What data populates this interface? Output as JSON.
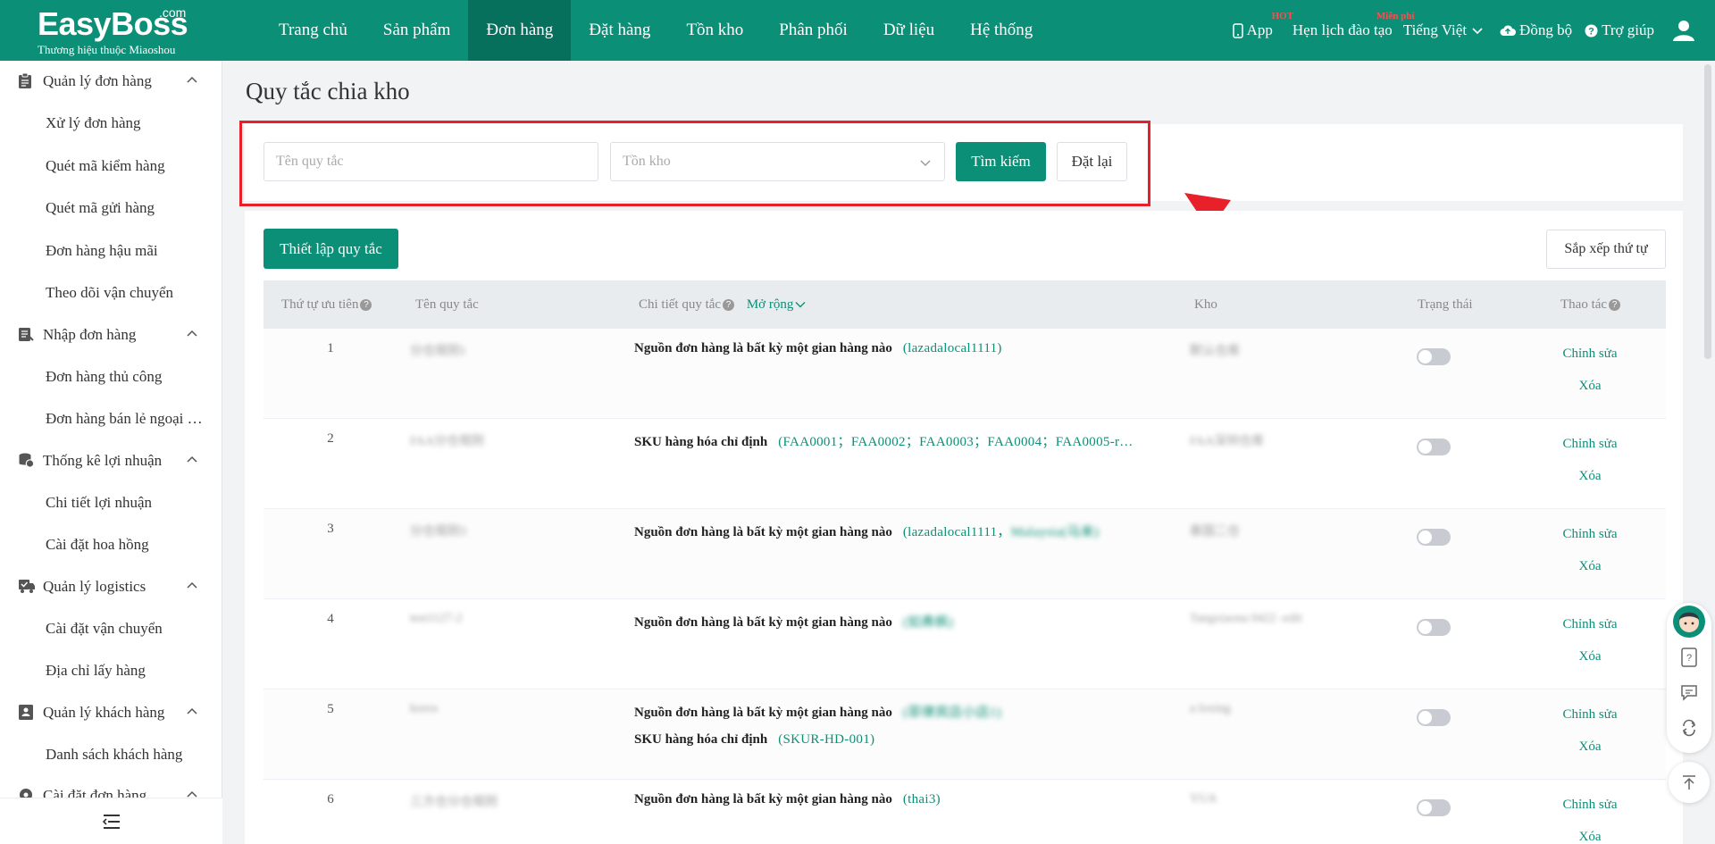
{
  "header": {
    "logo_text": "EasyBoss",
    "logo_suffix": ".com",
    "logo_sub": "Thương hiệu thuộc Miaoshou",
    "nav": [
      {
        "label": "Trang chủ",
        "active": false
      },
      {
        "label": "Sản phẩm",
        "active": false
      },
      {
        "label": "Đơn hàng",
        "active": true
      },
      {
        "label": "Đặt hàng",
        "active": false
      },
      {
        "label": "Tồn kho",
        "active": false
      },
      {
        "label": "Phân phối",
        "active": false
      },
      {
        "label": "Dữ liệu",
        "active": false
      },
      {
        "label": "Hệ thống",
        "active": false
      }
    ],
    "app_label": "App",
    "app_badge": "HOT",
    "training_label": "Hẹn lịch đào tạo",
    "training_badge": "Miễn phí",
    "language": "Tiếng Việt",
    "sync_label": "Đồng bộ",
    "help_label": "Trợ giúp"
  },
  "sidebar": {
    "groups": [
      {
        "title": "Quản lý đơn hàng",
        "icon": "clipboard-icon",
        "items": [
          "Xử lý đơn hàng",
          "Quét mã kiểm hàng",
          "Quét mã gửi hàng",
          "Đơn hàng hậu mãi",
          "Theo dõi vận chuyển"
        ]
      },
      {
        "title": "Nhập đơn hàng",
        "icon": "import-icon",
        "items": [
          "Đơn hàng thủ công",
          "Đơn hàng bán lẻ ngoại tuyến"
        ]
      },
      {
        "title": "Thống kê lợi nhuận",
        "icon": "coins-icon",
        "items": [
          "Chi tiết lợi nhuận",
          "Cài đặt hoa hồng"
        ]
      },
      {
        "title": "Quản lý logistics",
        "icon": "truck-icon",
        "items": [
          "Cài đặt vận chuyển",
          "Địa chỉ lấy hàng"
        ]
      },
      {
        "title": "Quản lý khách hàng",
        "icon": "contact-icon",
        "items": [
          "Danh sách khách hàng"
        ]
      },
      {
        "title": "Cài đặt đơn hàng",
        "icon": "settings-icon",
        "items": []
      }
    ]
  },
  "page": {
    "title": "Quy tắc chia kho",
    "filter": {
      "rule_name_placeholder": "Tên quy tắc",
      "warehouse_placeholder": "Tồn kho",
      "search_label": "Tìm kiếm",
      "reset_label": "Đặt lại"
    },
    "setup_rule_label": "Thiết lập quy tắc",
    "sort_order_label": "Sắp xếp thứ tự",
    "table": {
      "headers": {
        "priority": "Thứ tự ưu tiên",
        "rule_name": "Tên quy tắc",
        "rule_detail": "Chi tiết quy tắc",
        "expand": "Mở rộng",
        "warehouse": "Kho",
        "status": "Trạng thái",
        "actions": "Thao tác"
      },
      "edit_label": "Chỉnh sửa",
      "delete_label": "Xóa",
      "rows": [
        {
          "priority": "1",
          "name": "分仓规则1",
          "warehouse": "默认仓库",
          "rules": [
            {
              "label": "Nguồn đơn hàng là bất kỳ một gian hàng nào",
              "value": "(lazadalocal1111)",
              "blurred": ""
            }
          ]
        },
        {
          "priority": "2",
          "name": "FAA分仓规则",
          "warehouse": "FAA深圳仓库",
          "rules": [
            {
              "label": "SKU hàng hóa chỉ định",
              "value": "(FAA0001；FAA0002；FAA0003；FAA0004；FAA0005-r…",
              "blurred": ""
            }
          ]
        },
        {
          "priority": "3",
          "name": "分仓规则3",
          "warehouse": "泰国二仓",
          "rules": [
            {
              "label": "Nguồn đơn hàng là bất kỳ một gian hàng nào",
              "value": "(lazadalocal1111，",
              "blurred": "Malaysia(马来)"
            }
          ]
        },
        {
          "priority": "4",
          "name": "test1127-2",
          "warehouse": "Tangxiaona 0422 -edit",
          "rules": [
            {
              "label": "Nguồn đơn hàng là bất kỳ một gian hàng nào",
              "value": "",
              "blurred": "(如弗枫)"
            }
          ]
        },
        {
          "priority": "5",
          "name": "koros",
          "warehouse": "a loxing",
          "rules": [
            {
              "label": "Nguồn đơn hàng là bất kỳ một gian hàng nào",
              "value": "",
              "blurred": "(菲律宾店小店1)"
            },
            {
              "label": "SKU hàng hóa chỉ định",
              "value": "(SKUR-HD-001)",
              "blurred": ""
            }
          ]
        },
        {
          "priority": "6",
          "name": "三方仓分仓规则",
          "warehouse": "YUA",
          "rules": [
            {
              "label": "Nguồn đơn hàng là bất kỳ một gian hàng nào",
              "value": "(thai3)",
              "blurred": ""
            }
          ]
        }
      ]
    }
  },
  "colors": {
    "brand": "#0b8f77",
    "brand_dark": "#07705d",
    "highlight": "#e8202a"
  }
}
